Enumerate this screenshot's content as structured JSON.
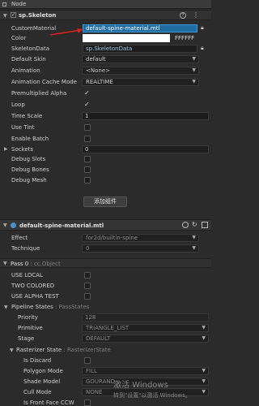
{
  "header": {
    "title": "Node"
  },
  "component": {
    "name": "sp.Skeleton",
    "fields": {
      "custom_material_label": "CustomMaterial",
      "custom_material_value": "default-spine-material.mtl",
      "color_label": "Color",
      "color_hex": "FFFFFF",
      "skeleton_data_label": "SkeletonData",
      "skeleton_data_value": "sp.SkeletonData",
      "default_skin_label": "Default Skin",
      "default_skin_value": "default",
      "animation_label": "Animation",
      "animation_value": "<None>",
      "anim_cache_label": "Animation Cache Mode",
      "anim_cache_value": "REALTIME",
      "premultiplied_label": "Premultiplied Alpha",
      "loop_label": "Loop",
      "time_scale_label": "Time Scale",
      "time_scale_value": "1",
      "use_tint_label": "Use Tint",
      "enable_batch_label": "Enable Batch",
      "sockets_label": "Sockets",
      "sockets_value": "0",
      "debug_slots_label": "Debug Slots",
      "debug_bones_label": "Debug Bones",
      "debug_mesh_label": "Debug Mesh"
    },
    "add_component_label": "添加组件"
  },
  "material": {
    "name": "default-spine-material.mtl",
    "effect_label": "Effect",
    "effect_value": "for2d/builtin-spine",
    "technique_label": "Technique",
    "technique_value": "0",
    "pass_title": "Pass 0",
    "pass_type": "cc.Object",
    "use_local_label": "USE LOCAL",
    "two_colored_label": "TWO COLORED",
    "use_alpha_test_label": "USE ALPHA TEST",
    "pipeline_label": "Pipeline States",
    "pipeline_type": "PassStates",
    "priority_label": "Priority",
    "priority_value": "128",
    "primitive_label": "Primitive",
    "primitive_value": "TRIANGLE_LIST",
    "stage_label": "Stage",
    "stage_value": "DEFAULT",
    "raster_label": "Rasterizer State",
    "raster_type": "RasterizerState",
    "is_discard_label": "Is Discard",
    "polygon_mode_label": "Polygon Mode",
    "polygon_mode_value": "FILL",
    "shade_model_label": "Shade Model",
    "shade_model_value": "GOURAND",
    "cull_mode_label": "Cull Mode",
    "cull_mode_value": "NONE",
    "front_face_label": "Is Front Face CCW"
  },
  "watermark": {
    "line1": "激活 Windows",
    "line2": "转到\"设置\"以激活 Windows。"
  },
  "colors": {
    "accent": "#3c8ec8",
    "selected_field": "#1e6aa6",
    "bg": "#2b2b2b"
  }
}
